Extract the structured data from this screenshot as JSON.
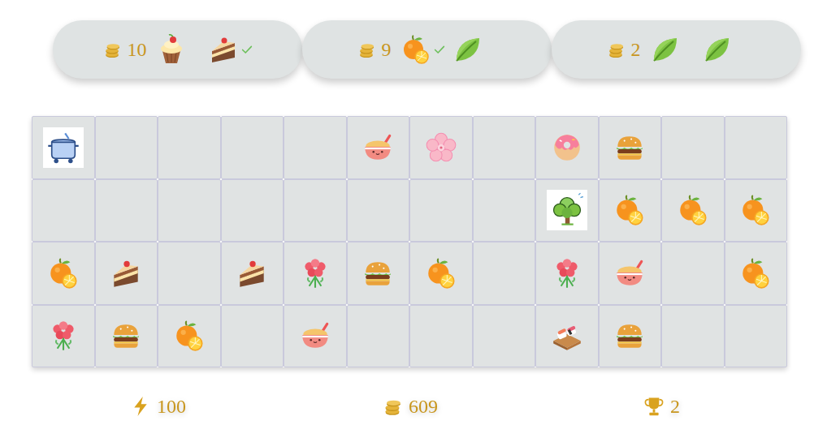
{
  "orders": [
    {
      "reward": "10",
      "items": [
        {
          "kind": "cupcake",
          "fulfilled": false
        },
        {
          "kind": "cake",
          "fulfilled": true
        }
      ]
    },
    {
      "reward": "9",
      "items": [
        {
          "kind": "orange",
          "fulfilled": true
        },
        {
          "kind": "leaf",
          "fulfilled": false
        }
      ]
    },
    {
      "reward": "2",
      "items": [
        {
          "kind": "leaf",
          "fulfilled": false
        },
        {
          "kind": "leaf",
          "fulfilled": false
        }
      ]
    }
  ],
  "board": {
    "rows": [
      [
        {
          "kind": "pot"
        },
        {
          "kind": "empty"
        },
        {
          "kind": "empty"
        },
        {
          "kind": "empty"
        },
        {
          "kind": "empty"
        },
        {
          "kind": "rice"
        },
        {
          "kind": "sakura"
        },
        {
          "kind": "empty"
        },
        {
          "kind": "donut"
        },
        {
          "kind": "burger"
        },
        {
          "kind": "empty"
        },
        {
          "kind": "empty"
        }
      ],
      [
        {
          "kind": "empty"
        },
        {
          "kind": "empty"
        },
        {
          "kind": "empty"
        },
        {
          "kind": "empty"
        },
        {
          "kind": "empty"
        },
        {
          "kind": "empty"
        },
        {
          "kind": "empty"
        },
        {
          "kind": "empty"
        },
        {
          "kind": "tree"
        },
        {
          "kind": "orange"
        },
        {
          "kind": "orange"
        },
        {
          "kind": "orange"
        }
      ],
      [
        {
          "kind": "orange"
        },
        {
          "kind": "cake"
        },
        {
          "kind": "empty"
        },
        {
          "kind": "cake"
        },
        {
          "kind": "flowers"
        },
        {
          "kind": "burger"
        },
        {
          "kind": "orange"
        },
        {
          "kind": "empty"
        },
        {
          "kind": "flowers"
        },
        {
          "kind": "rice"
        },
        {
          "kind": "empty"
        },
        {
          "kind": "orange"
        }
      ],
      [
        {
          "kind": "flowers"
        },
        {
          "kind": "burger"
        },
        {
          "kind": "orange"
        },
        {
          "kind": "empty"
        },
        {
          "kind": "rice"
        },
        {
          "kind": "empty"
        },
        {
          "kind": "empty"
        },
        {
          "kind": "empty"
        },
        {
          "kind": "sushi"
        },
        {
          "kind": "burger"
        },
        {
          "kind": "empty"
        },
        {
          "kind": "empty"
        }
      ]
    ]
  },
  "stats": {
    "energy": "100",
    "coins": "609",
    "trophies": "2"
  }
}
